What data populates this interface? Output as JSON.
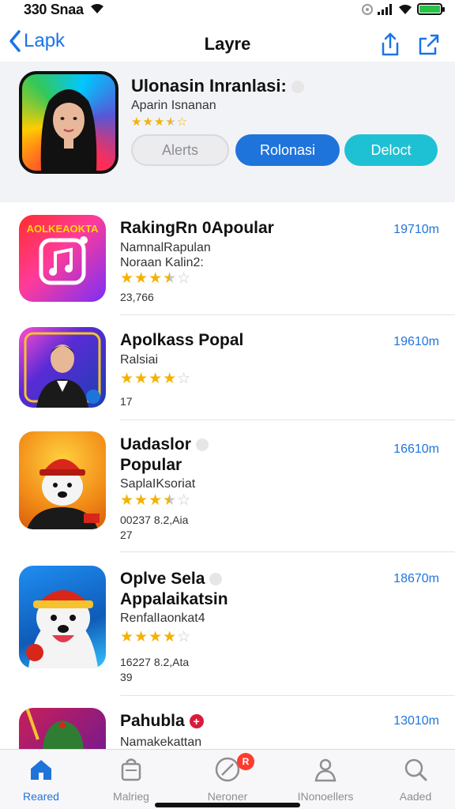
{
  "status": {
    "time": "330 Snaa"
  },
  "nav": {
    "back_label": "Lapk",
    "title": "Layre"
  },
  "header": {
    "title": "Ulonasin Inranlasi:",
    "subtitle": "Aparin Isnanan",
    "rating": 3.5,
    "buttons": {
      "alerts": "Alerts",
      "release": "Rolonasi",
      "detect": "Deloct"
    }
  },
  "apps": [
    {
      "name": "RakingRn 0Apoular",
      "sub1": "NamnalRapulan",
      "sub2": "Noraan Kalin2:",
      "rating": 3.5,
      "meta1": "23,766",
      "meta2": "",
      "size": "19710m",
      "icon_label": "AOLKEAOKTA"
    },
    {
      "name": "Apolkass Popal",
      "sub1": "Ralsiai",
      "sub2": "",
      "rating": 4,
      "meta1": "17",
      "meta2": "",
      "size": "19610m"
    },
    {
      "name": "Uadaslor",
      "name2": "Popular",
      "sub1": "SaplaIKsoriat",
      "sub2": "",
      "rating": 3.5,
      "meta1": "00237 8.2,Aia",
      "meta2": "27",
      "size": "16610m"
    },
    {
      "name": "Oplve Sela",
      "name2": "Appalaikatsin",
      "sub1": "RenfalIaonkat4",
      "sub2": "",
      "rating": 4,
      "meta1": "16227 8.2,Ata",
      "meta2": "39",
      "size": "18670m"
    },
    {
      "name": "Pahubla",
      "sub1": "Namakekattan",
      "sub2": "",
      "size": "13010m"
    }
  ],
  "tabs": [
    {
      "label": "Reared",
      "icon": "house-icon",
      "active": true
    },
    {
      "label": "Malrieg",
      "icon": "bag-icon"
    },
    {
      "label": "Neroner",
      "icon": "compass-icon",
      "badge": "R"
    },
    {
      "label": "INonoellers",
      "icon": "person-icon"
    },
    {
      "label": "Aaded",
      "icon": "search-icon"
    }
  ],
  "colors": {
    "accent": "#1f74db",
    "star": "#f5b100",
    "teal": "#1ec1d4",
    "badge": "#ff3b30"
  }
}
